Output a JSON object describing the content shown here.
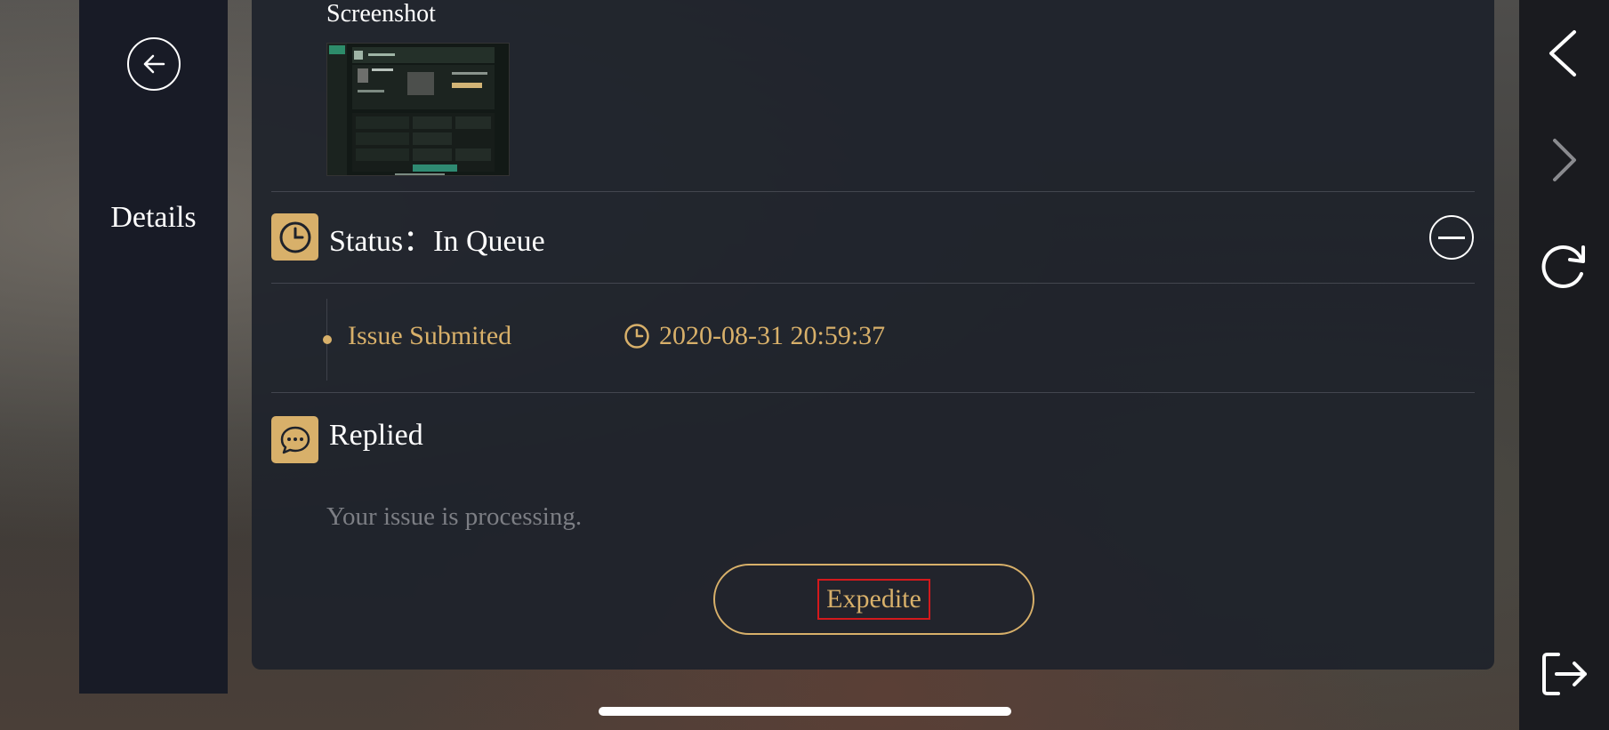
{
  "nav": {
    "title": "Details",
    "back_icon": "arrow-left-circle-icon"
  },
  "ticket": {
    "screenshot_label": "Screenshot",
    "status_label": "Status：In Queue",
    "status_icon": "clock-icon",
    "collapse_icon": "minus-circle-icon",
    "timeline": [
      {
        "event": "Issue Submited",
        "time": "2020-08-31 20:59:37"
      }
    ],
    "replied_label": "Replied",
    "replied_icon": "chat-bubble-icon",
    "reply_body": "Your issue is processing.",
    "expedite_label": "Expedite"
  },
  "right_bar": {
    "icons": [
      "chevron-left-icon",
      "chevron-right-icon",
      "refresh-icon",
      "exit-icon"
    ]
  },
  "colors": {
    "accent_gold": "#d8b06a",
    "panel_bg": "#1e222b",
    "nav_bg": "#181b26",
    "highlight_red": "#d3191c"
  }
}
